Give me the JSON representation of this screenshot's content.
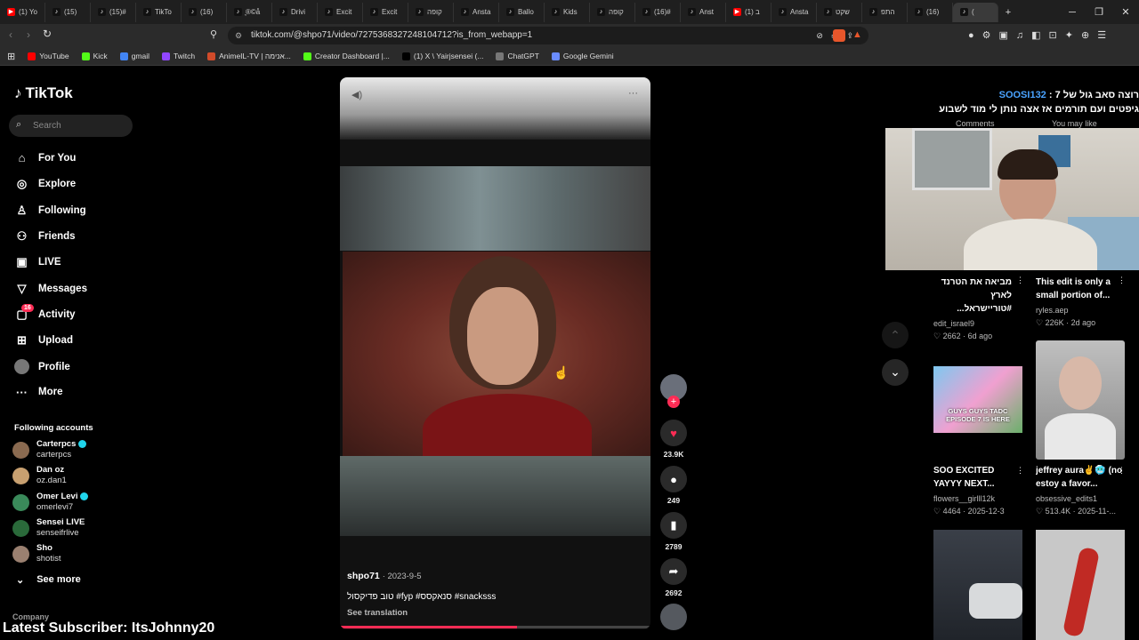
{
  "browser": {
    "tabs": [
      {
        "label": "(1) Yo",
        "icon": "youtube-icon"
      },
      {
        "label": "(15)",
        "icon": "tiktok-icon"
      },
      {
        "label": "(15)#",
        "icon": "tiktok-icon"
      },
      {
        "label": "TikTo",
        "icon": "tiktok-icon"
      },
      {
        "label": "(16)",
        "icon": "tiktok-icon"
      },
      {
        "label": "ֳ®©å",
        "icon": "tiktok-icon"
      },
      {
        "label": "Drivi",
        "icon": "tiktok-icon"
      },
      {
        "label": "Excit",
        "icon": "tiktok-icon"
      },
      {
        "label": "Excit",
        "icon": "tiktok-icon"
      },
      {
        "label": "קופה",
        "icon": "tiktok-icon"
      },
      {
        "label": "Ansta",
        "icon": "tiktok-icon"
      },
      {
        "label": "Ballo",
        "icon": "tiktok-icon"
      },
      {
        "label": "Kids",
        "icon": "tiktok-icon"
      },
      {
        "label": "קופה",
        "icon": "tiktok-icon"
      },
      {
        "label": "(16)#",
        "icon": "tiktok-icon"
      },
      {
        "label": "Anst",
        "icon": "tiktok-icon"
      },
      {
        "label": "(1) ב",
        "icon": "youtube-icon"
      },
      {
        "label": "Ansta",
        "icon": "tiktok-icon"
      },
      {
        "label": "שקט",
        "icon": "tiktok-icon"
      },
      {
        "label": "התפ",
        "icon": "tiktok-icon"
      },
      {
        "label": "(16)",
        "icon": "tiktok-icon"
      },
      {
        "label": "(",
        "icon": "tiktok-icon"
      }
    ],
    "new_tab": "+",
    "window_controls": {
      "minimize": "─",
      "restore": "❐",
      "close": "✕"
    },
    "url": "tiktok.com/@shpo71/video/7275368327248104712?is_from_webapp=1",
    "bookmarks": [
      {
        "label": "YouTube",
        "color": "#ff0000"
      },
      {
        "label": "Kick",
        "color": "#53fc18"
      },
      {
        "label": "gmail",
        "color": "#4285f4"
      },
      {
        "label": "Twitch",
        "color": "#9146ff"
      },
      {
        "label": "AnimeIL-TV | אנימה...",
        "color": "#d14b2a"
      },
      {
        "label": "Creator Dashboard |...",
        "color": "#53fc18"
      },
      {
        "label": "(1) X \\ Yairjsensei (...",
        "color": "#000000"
      },
      {
        "label": "ChatGPT",
        "color": "#777777"
      },
      {
        "label": "Google Gemini",
        "color": "#6a8cff"
      }
    ]
  },
  "sidebar": {
    "logo": "TikTok",
    "search_placeholder": "Search",
    "nav": [
      {
        "label": "For You",
        "icon": "home-icon",
        "glyph": "⌂"
      },
      {
        "label": "Explore",
        "icon": "compass-icon",
        "glyph": "◎"
      },
      {
        "label": "Following",
        "icon": "following-icon",
        "glyph": "♙"
      },
      {
        "label": "Friends",
        "icon": "friends-icon",
        "glyph": "⚇"
      },
      {
        "label": "LIVE",
        "icon": "live-icon",
        "glyph": "▣"
      },
      {
        "label": "Messages",
        "icon": "messages-icon",
        "glyph": "▽"
      },
      {
        "label": "Activity",
        "icon": "activity-icon",
        "glyph": "▢"
      },
      {
        "label": "Upload",
        "icon": "upload-icon",
        "glyph": "⊞"
      },
      {
        "label": "Profile",
        "icon": "profile-icon",
        "glyph": "●"
      },
      {
        "label": "More",
        "icon": "more-icon",
        "glyph": "···"
      }
    ],
    "activity_badge": "16",
    "following_title": "Following accounts",
    "accounts": [
      {
        "name": "Carterpcs",
        "handle": "carterpcs",
        "verified": true
      },
      {
        "name": "Dan oz",
        "handle": "oz.dan1",
        "verified": false
      },
      {
        "name": "Omer Levi",
        "handle": "omerlevi7",
        "verified": true
      },
      {
        "name": "Sensei LIVE",
        "handle": "senseifrlive",
        "verified": false
      },
      {
        "name": "Sho",
        "handle": "shotist",
        "verified": false
      }
    ],
    "see_more": "See more",
    "company": "Company"
  },
  "video": {
    "author": "shpo71",
    "date": "· 2023-9-5",
    "caption": "טוב פדיקסול #fyp #סנאקסס #snacksss",
    "see_translation": "See translation",
    "progress": 0.57
  },
  "actions": {
    "likes": "23.9K",
    "comments": "249",
    "saves": "2789",
    "shares": "2692"
  },
  "overlay": {
    "chat_user": "SOOSI132",
    "chat_line1": "רוצה סאב גול של 7 :",
    "chat_line2": "גיפטים ועם תורמים אז אצה נותן לי מוד לשבוע",
    "tab_comments": "Comments",
    "tab_you_may_like": "You may like",
    "latest_sub": "Latest Subscriber: ItsJohnny20"
  },
  "recommended": [
    {
      "title": "מביאה את הטרנד לארץ #טוריישראל...",
      "user": "edit_israel9",
      "stats": "♡ 2662 · 6d ago"
    },
    {
      "title": "This edit is only a small portion of...",
      "user": "ryles.aep",
      "stats": "♡ 226K · 2d ago"
    },
    {
      "title": "SOO EXCITED YAYYY NEXT...",
      "user": "flowers__girlll12k",
      "stats": "♡ 4464 · 2025-12-3",
      "thumb_text": "GUYS GUYS TADC EPISODE 7 IS HERE"
    },
    {
      "title": "jeffrey aura✌️🥶 (no estoy a favor...",
      "user": "obsessive_edits1",
      "stats": "♡ 513.4K · 2025-11-..."
    }
  ]
}
